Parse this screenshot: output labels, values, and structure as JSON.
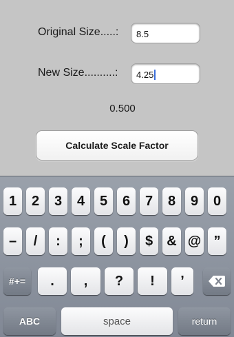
{
  "form": {
    "original_label": "Original Size.....:",
    "original_value": "8.5",
    "new_label": "New Size..........:",
    "new_value": "4.25",
    "result": "0.500",
    "calculate_label": "Calculate Scale Factor"
  },
  "keyboard": {
    "row1": [
      "1",
      "2",
      "3",
      "4",
      "5",
      "6",
      "7",
      "8",
      "9",
      "0"
    ],
    "row2": [
      "–",
      "/",
      ":",
      ";",
      "(",
      ")",
      "$",
      "&",
      "@",
      "”"
    ],
    "row3": [
      ".",
      ",",
      "?",
      "!",
      "’"
    ],
    "mode_label": "#+=",
    "delete_icon": "backspace-icon",
    "abc_label": "ABC",
    "space_label": "space",
    "return_label": "return"
  },
  "colors": {
    "background": "#c5c5c5",
    "keyboard": "#8d939d",
    "caret": "#3b6fdc"
  }
}
